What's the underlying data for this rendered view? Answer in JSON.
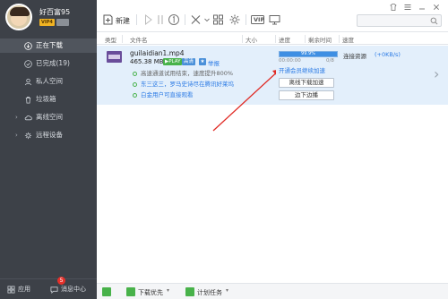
{
  "colors": {
    "sidebar_bg": "#3d4148",
    "accent": "#2c7be5",
    "selected_row": "#e3effb",
    "progress_fill": "#3f8fe3",
    "green": "#48b24a"
  },
  "user": {
    "name": "好百富95",
    "vip_label": "VIP4"
  },
  "sidebar": {
    "items": [
      {
        "label": "正在下载",
        "icon": "download-icon",
        "active": true,
        "caret": ""
      },
      {
        "label": "已完成(19)",
        "icon": "check-circle-icon",
        "active": false,
        "caret": ""
      },
      {
        "label": "私人空间",
        "icon": "private-space-icon",
        "active": false,
        "caret": ""
      },
      {
        "label": "垃圾箱",
        "icon": "trash-icon",
        "active": false,
        "caret": ""
      },
      {
        "label": "离线空间",
        "icon": "cloud-icon",
        "active": false,
        "caret": "›"
      },
      {
        "label": "远程设备",
        "icon": "remote-device-icon",
        "active": false,
        "caret": "›"
      }
    ]
  },
  "bottom": {
    "apps_label": "应用",
    "messages_label": "消息中心",
    "message_count": "5"
  },
  "toolbar": {
    "new_label": "新建",
    "vip_label": "VIP"
  },
  "columns": {
    "type": "类型",
    "filename": "文件名",
    "size": "大小",
    "progress": "进度",
    "remaining": "剩余时间",
    "speed": "速度"
  },
  "task": {
    "filename": "guilaidian1.mp4",
    "size": "465.38 MB",
    "play_chip": "▶PLAY",
    "hd_chip": "高清",
    "report_link": "举报",
    "tip1": "高速通道试用结束，速度提升800%",
    "tip2": "东三这三，罗马史诗尽在腾讯好莱坞",
    "tip3": "白金用户可直接观看",
    "progress_percent": 99.9,
    "progress_text": "99.9%",
    "eta": "00:00:00",
    "connections": "0/8",
    "status": "连接资源",
    "speed": "(+0KB/s)",
    "vip_link": "开通会员继续加速",
    "offline_button": "离线下载加速",
    "play_button": "边下边播"
  },
  "status_bar": {
    "priority_label": "下载优先",
    "schedule_label": "计划任务"
  }
}
